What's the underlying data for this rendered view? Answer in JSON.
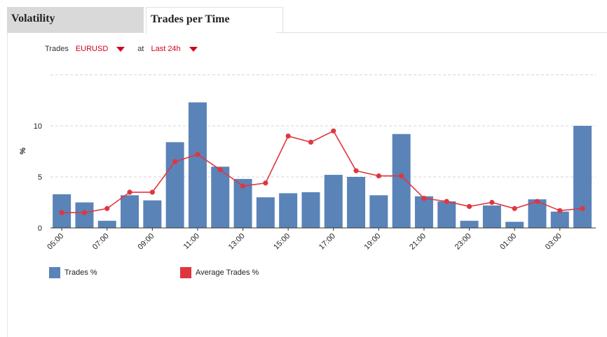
{
  "tabs": [
    {
      "label": "Volatility",
      "active": false
    },
    {
      "label": "Trades per Time",
      "active": true
    }
  ],
  "filters": {
    "trades_label": "Trades",
    "symbol": "EURUSD",
    "at_label": "at",
    "period": "Last 24h"
  },
  "legend": {
    "trades": "Trades %",
    "average": "Average Trades %"
  },
  "colors": {
    "bar": "#5a83b8",
    "line": "#e0363f",
    "accent": "#d4001a"
  },
  "chart_data": {
    "type": "bar",
    "ylabel": "%",
    "ylim": [
      0,
      15
    ],
    "yticks": [
      "0",
      "5",
      "10"
    ],
    "grid": true,
    "legend_position": "bottom-left",
    "xtick_labels": [
      "05:00",
      "07:00",
      "09:00",
      "11:00",
      "13:00",
      "15:00",
      "17:00",
      "19:00",
      "21:00",
      "23:00",
      "01:00",
      "03:00"
    ],
    "categories": [
      "05:00",
      "06:00",
      "07:00",
      "08:00",
      "09:00",
      "10:00",
      "11:00",
      "12:00",
      "13:00",
      "14:00",
      "15:00",
      "16:00",
      "17:00",
      "18:00",
      "19:00",
      "20:00",
      "21:00",
      "22:00",
      "23:00",
      "00:00",
      "01:00",
      "02:00",
      "03:00",
      "04:00"
    ],
    "series": [
      {
        "name": "Trades %",
        "kind": "bar",
        "values": [
          3.3,
          2.5,
          0.7,
          3.2,
          2.7,
          8.4,
          12.3,
          6.0,
          4.8,
          3.0,
          3.4,
          3.5,
          5.2,
          5.0,
          3.2,
          9.2,
          3.1,
          2.6,
          0.7,
          2.2,
          0.6,
          2.8,
          1.6,
          10.0
        ]
      },
      {
        "name": "Average Trades %",
        "kind": "line",
        "values": [
          1.5,
          1.5,
          1.9,
          3.5,
          3.5,
          6.5,
          7.2,
          5.7,
          4.1,
          4.4,
          9.0,
          8.4,
          9.5,
          5.6,
          5.1,
          5.1,
          2.9,
          2.6,
          2.1,
          2.5,
          1.9,
          2.6,
          1.7,
          1.9
        ]
      }
    ]
  }
}
